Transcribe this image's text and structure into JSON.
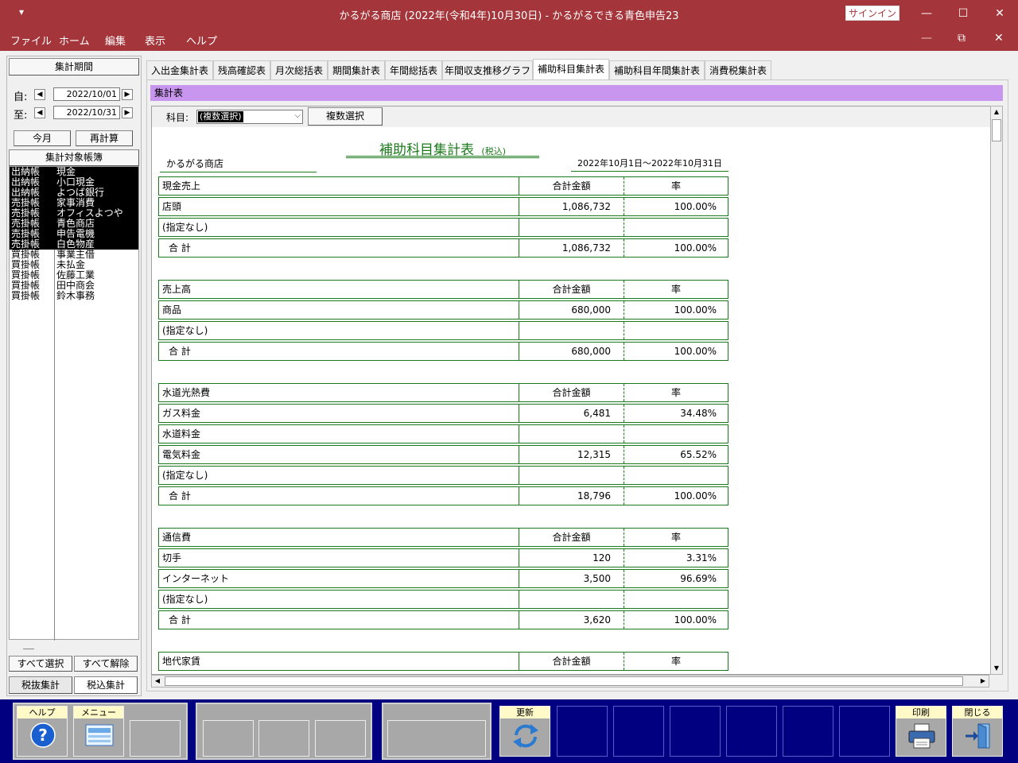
{
  "window": {
    "title": "かるがる商店 (2022年(令和4年)10月30日)  -  かるがるできる青色申告23",
    "signin": "サインイン",
    "minimize": "—",
    "maximize": "☐",
    "close": "✕",
    "restore": "⧉",
    "quick_access": "▾"
  },
  "menu": [
    "ファイル",
    "ホーム",
    "編集",
    "表示",
    "ヘルプ"
  ],
  "left": {
    "period_button": "集計期間",
    "from_label": "自:",
    "to_label": "至:",
    "from_date": "2022/10/01",
    "to_date": "2022/10/31",
    "this_month": "今月",
    "recalc": "再計算",
    "books_header": "集計対象帳簿",
    "books": [
      {
        "book": "出納帳",
        "account": "現金",
        "selected": true
      },
      {
        "book": "出納帳",
        "account": "小口現金",
        "selected": true
      },
      {
        "book": "出納帳",
        "account": "よつば銀行",
        "selected": true
      },
      {
        "book": "売掛帳",
        "account": "家事消費",
        "selected": true
      },
      {
        "book": "売掛帳",
        "account": "オフィスよつや",
        "selected": true
      },
      {
        "book": "売掛帳",
        "account": "青色商店",
        "selected": true
      },
      {
        "book": "売掛帳",
        "account": "申告電機",
        "selected": true
      },
      {
        "book": "売掛帳",
        "account": "白色物産",
        "selected": true
      },
      {
        "book": "買掛帳",
        "account": "事業主借",
        "selected": false
      },
      {
        "book": "買掛帳",
        "account": "未払金",
        "selected": false
      },
      {
        "book": "買掛帳",
        "account": "佐藤工業",
        "selected": false
      },
      {
        "book": "買掛帳",
        "account": "田中商会",
        "selected": false
      },
      {
        "book": "買掛帳",
        "account": "鈴木事務",
        "selected": false
      }
    ],
    "select_all": "すべて選択",
    "deselect_all": "すべて解除",
    "tax_excl": "税抜集計",
    "tax_incl": "税込集計"
  },
  "tabs": [
    "入出金集計表",
    "残高確認表",
    "月次総括表",
    "期間集計表",
    "年間総括表",
    "年間収支推移グラフ",
    "補助科目集計表",
    "補助科目年間集計表",
    "消費税集計表"
  ],
  "panel_title": "集計表",
  "toolbar": {
    "account_label": "科目:",
    "account_value": "(複数選択)",
    "multi_select": "複数選択"
  },
  "report": {
    "title": "補助科目集計表",
    "tax_note": "(税込)",
    "company": "かるがる商店",
    "period": "2022年10月1日～2022年10月31日",
    "col_amount": "合計金額",
    "col_rate": "率",
    "total_label": "合 計",
    "sections": [
      {
        "name": "現金売上",
        "rows": [
          {
            "label": "店頭",
            "amount": "1,086,732",
            "rate": "100.00%"
          },
          {
            "label": "(指定なし)",
            "amount": "",
            "rate": ""
          }
        ],
        "total": {
          "amount": "1,086,732",
          "rate": "100.00%"
        }
      },
      {
        "name": "売上高",
        "rows": [
          {
            "label": "商品",
            "amount": "680,000",
            "rate": "100.00%"
          },
          {
            "label": "(指定なし)",
            "amount": "",
            "rate": ""
          }
        ],
        "total": {
          "amount": "680,000",
          "rate": "100.00%"
        }
      },
      {
        "name": "水道光熱費",
        "rows": [
          {
            "label": "ガス料金",
            "amount": "6,481",
            "rate": "34.48%"
          },
          {
            "label": "水道料金",
            "amount": "",
            "rate": ""
          },
          {
            "label": "電気料金",
            "amount": "12,315",
            "rate": "65.52%"
          },
          {
            "label": "(指定なし)",
            "amount": "",
            "rate": ""
          }
        ],
        "total": {
          "amount": "18,796",
          "rate": "100.00%"
        }
      },
      {
        "name": "通信費",
        "rows": [
          {
            "label": "切手",
            "amount": "120",
            "rate": "3.31%"
          },
          {
            "label": "インターネット",
            "amount": "3,500",
            "rate": "96.69%"
          },
          {
            "label": "(指定なし)",
            "amount": "",
            "rate": ""
          }
        ],
        "total": {
          "amount": "3,620",
          "rate": "100.00%"
        }
      },
      {
        "name": "地代家賃",
        "rows": [],
        "total": null
      }
    ]
  },
  "fkeys": {
    "help": "ヘルプ",
    "menu": "メニュー",
    "refresh": "更新",
    "print": "印刷",
    "close": "閉じる"
  },
  "colors": {
    "titlebar": "#a4353a",
    "panel_header": "#c896ee",
    "table_border": "#1b7a1b",
    "bottom_bar": "#000080"
  }
}
